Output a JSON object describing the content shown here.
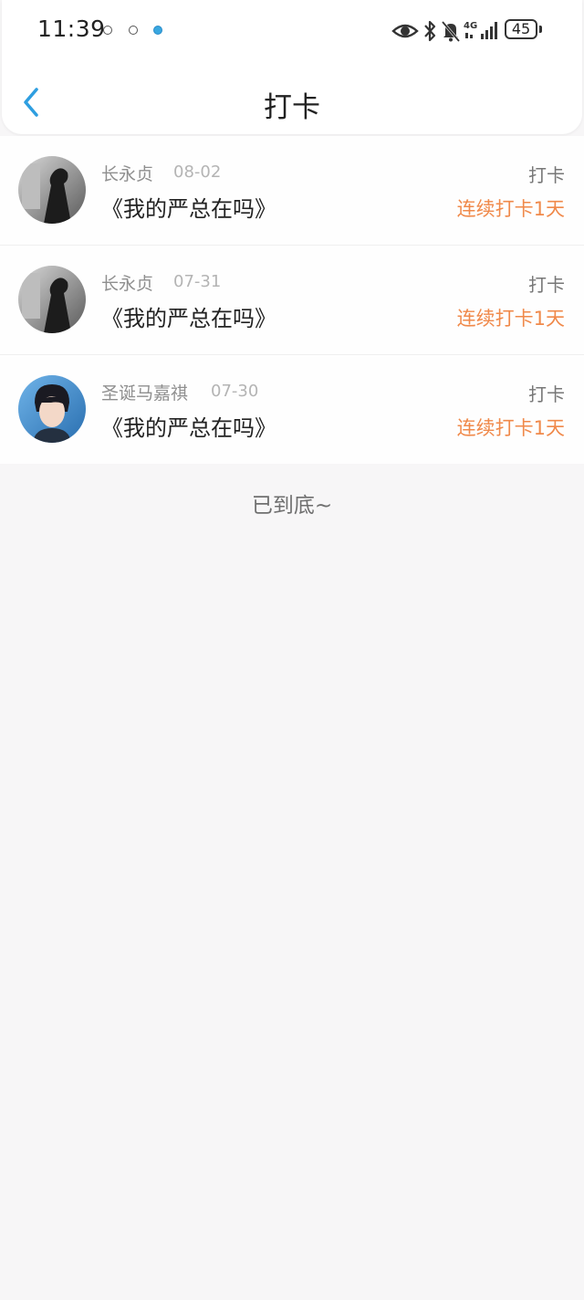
{
  "status_bar": {
    "time": "11:39",
    "battery": "45",
    "network": "4G",
    "icons": [
      "notification-icon",
      "notification-icon",
      "notification-icon",
      "eye-icon",
      "bluetooth-icon",
      "bell-muted-icon",
      "signal-icon",
      "battery-icon"
    ]
  },
  "header": {
    "title": "打卡",
    "back_icon": "chevron-left-icon",
    "accent_color": "#2e9ee0"
  },
  "records": [
    {
      "username": "长永贞",
      "date": "08-02",
      "book": "《我的严总在吗》",
      "type": "打卡",
      "streak": "连续打卡1天",
      "avatar": "avatar-bw"
    },
    {
      "username": "长永贞",
      "date": "07-31",
      "book": "《我的严总在吗》",
      "type": "打卡",
      "streak": "连续打卡1天",
      "avatar": "avatar-bw"
    },
    {
      "username": "圣诞马嘉祺",
      "date": "07-30",
      "book": "《我的严总在吗》",
      "type": "打卡",
      "streak": "连续打卡1天",
      "avatar": "avatar-blue"
    }
  ],
  "footer": {
    "end_text": "已到底~"
  },
  "colors": {
    "streak": "#f0894a",
    "background": "#f7f6f7"
  }
}
